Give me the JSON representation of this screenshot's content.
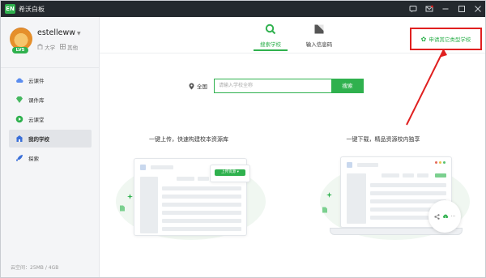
{
  "titlebar": {
    "app_logo": "EN",
    "app_title": "希沃白板",
    "controls": [
      "feedback-icon",
      "mail-icon",
      "minimize-icon",
      "restore-icon",
      "close-icon"
    ]
  },
  "user": {
    "name": "estelleww",
    "level": "LV5",
    "school_type": "大学",
    "org": "其他"
  },
  "sidebar": {
    "items": [
      {
        "label": "云课件",
        "icon": "cloud-icon",
        "active": false
      },
      {
        "label": "课件库",
        "icon": "gem-icon",
        "active": false
      },
      {
        "label": "云课堂",
        "icon": "play-icon",
        "active": false
      },
      {
        "label": "我的学校",
        "icon": "school-icon",
        "active": true
      },
      {
        "label": "探索",
        "icon": "rocket-icon",
        "active": false
      }
    ],
    "storage": "云空间：25MB / 4GB"
  },
  "tabs": [
    {
      "label": "搜索学校",
      "icon": "search-icon",
      "active": true
    },
    {
      "label": "输入信息码",
      "icon": "code-icon",
      "active": false
    }
  ],
  "apply_link": "申请其它类型学校",
  "search": {
    "region": "全国",
    "placeholder": "请输入学校全称",
    "button": "搜索"
  },
  "features": {
    "left_title": "一键上传，快速构建校本资源库",
    "upload_pill": "上传资源 ▾",
    "right_title": "一键下载，精品资源校内独享"
  },
  "colors": {
    "accent": "#2fb14e",
    "highlight": "#e02020",
    "titlebar": "#24292e"
  }
}
